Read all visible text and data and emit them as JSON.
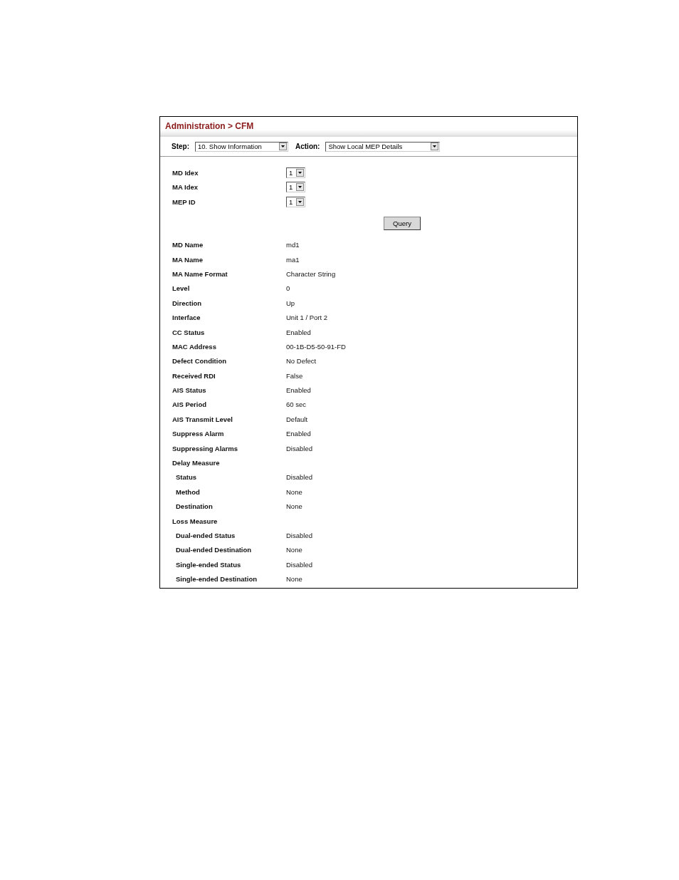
{
  "breadcrumb": "Administration > CFM",
  "step": {
    "label": "Step:",
    "value": "10. Show Information"
  },
  "action": {
    "label": "Action:",
    "value": "Show Local MEP Details"
  },
  "selectors": [
    {
      "label": "MD Idex",
      "value": "1"
    },
    {
      "label": "MA Idex",
      "value": "1"
    },
    {
      "label": "MEP ID",
      "value": "1"
    }
  ],
  "query_button": "Query",
  "details": [
    {
      "label": "MD Name",
      "value": "md1"
    },
    {
      "label": "MA Name",
      "value": "ma1"
    },
    {
      "label": "MA Name Format",
      "value": "Character String"
    },
    {
      "label": "Level",
      "value": "0"
    },
    {
      "label": "Direction",
      "value": "Up"
    },
    {
      "label": "Interface",
      "value": "Unit 1 / Port 2"
    },
    {
      "label": "CC Status",
      "value": "Enabled"
    },
    {
      "label": "MAC Address",
      "value": "00-1B-D5-50-91-FD"
    },
    {
      "label": "Defect Condition",
      "value": "No Defect"
    },
    {
      "label": "Received RDI",
      "value": "False"
    },
    {
      "label": "AIS Status",
      "value": "Enabled"
    },
    {
      "label": "AIS Period",
      "value": "60 sec"
    },
    {
      "label": "AIS Transmit Level",
      "value": "Default"
    },
    {
      "label": "Suppress Alarm",
      "value": "Enabled"
    },
    {
      "label": "Suppressing Alarms",
      "value": "Disabled"
    },
    {
      "label": "Delay Measure",
      "children": [
        {
          "label": "Status",
          "value": "Disabled"
        },
        {
          "label": "Method",
          "value": "None"
        },
        {
          "label": "Destination",
          "value": "None"
        }
      ]
    },
    {
      "label": "Loss Measure",
      "children": [
        {
          "label": "Dual-ended Status",
          "value": "Disabled"
        },
        {
          "label": "Dual-ended Destination",
          "value": "None"
        },
        {
          "label": "Single-ended Status",
          "value": "Disabled"
        },
        {
          "label": "Single-ended Destination",
          "value": "None"
        }
      ]
    }
  ]
}
